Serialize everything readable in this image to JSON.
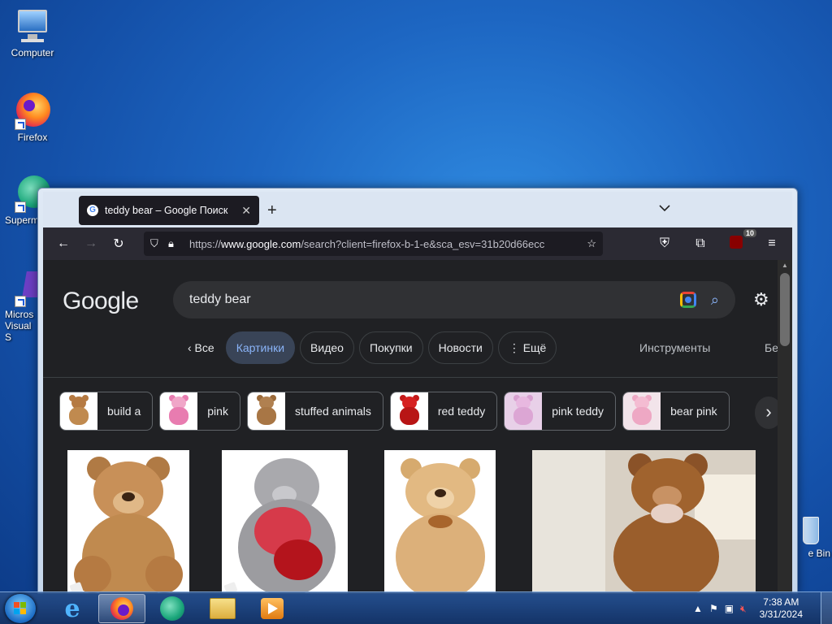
{
  "desktop": {
    "icons": [
      {
        "label": "Computer"
      },
      {
        "label": "Firefox"
      },
      {
        "label": "Superm"
      },
      {
        "label": "Micros Visual S"
      },
      {
        "label": "e Bin"
      }
    ]
  },
  "browser": {
    "tab_title": "teddy bear – Google Поиск",
    "favicon": "G",
    "new_tab": "+",
    "tab_list": "⌄",
    "url_domain": "www.google.com",
    "url_prefix": "https://",
    "url_rest": "/search?client=firefox-b-1-e&sca_esv=31b20d66ecc",
    "ext_badge": "10"
  },
  "google": {
    "logo": "Google",
    "query": "teddy bear",
    "tabs": [
      {
        "label": "‹  Все"
      },
      {
        "label": "Картинки"
      },
      {
        "label": "Видео"
      },
      {
        "label": "Покупки"
      },
      {
        "label": "Новости"
      },
      {
        "label": "⋮ Ещё"
      }
    ],
    "tools": "Инструменты",
    "tools_more": "Бе",
    "refinements": [
      {
        "label": "build a"
      },
      {
        "label": "pink"
      },
      {
        "label": "stuffed animals"
      },
      {
        "label": "red teddy"
      },
      {
        "label": "pink teddy"
      },
      {
        "label": "bear pink"
      }
    ],
    "next_arrow": "›"
  },
  "taskbar": {
    "time": "7:38 AM",
    "date": "3/31/2024"
  },
  "colors": {
    "accent": "#8ab4f8",
    "active_tab_bg": "#394457",
    "page_bg": "#202124",
    "bear_brown": "#c08a4f",
    "bear_pink": "#f0a6c8"
  }
}
